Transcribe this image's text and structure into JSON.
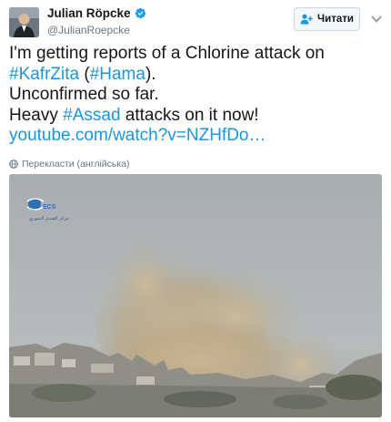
{
  "author": {
    "display_name": "Julian Röpcke",
    "handle": "@JulianRoepcke",
    "verified": true
  },
  "follow_button": {
    "label": "Читати",
    "icon": "add-user-icon"
  },
  "more_icon": "chevron-down-icon",
  "tweet": {
    "line1": "I'm getting reports of a Chlorine attack on",
    "line2": {
      "hashtag1": "#KafrZita",
      "open_paren": " (",
      "hashtag2": "#Hama",
      "close_paren": ")."
    },
    "line3": "Unconfirmed so far.",
    "line4": {
      "before": "Heavy ",
      "hashtag": "#Assad",
      "after": " attacks on it now!"
    },
    "link": "youtube.com/watch?v=NZHfDo…"
  },
  "translate": {
    "icon": "globe-icon",
    "label": "Перекласти (англійська)"
  },
  "media": {
    "logo_text": "ECS",
    "logo_subtext": "مركز الصدى السوري"
  },
  "colors": {
    "link": "#1b95e0",
    "text": "#14171a",
    "muted": "#657786",
    "verified": "#1da1f2"
  }
}
